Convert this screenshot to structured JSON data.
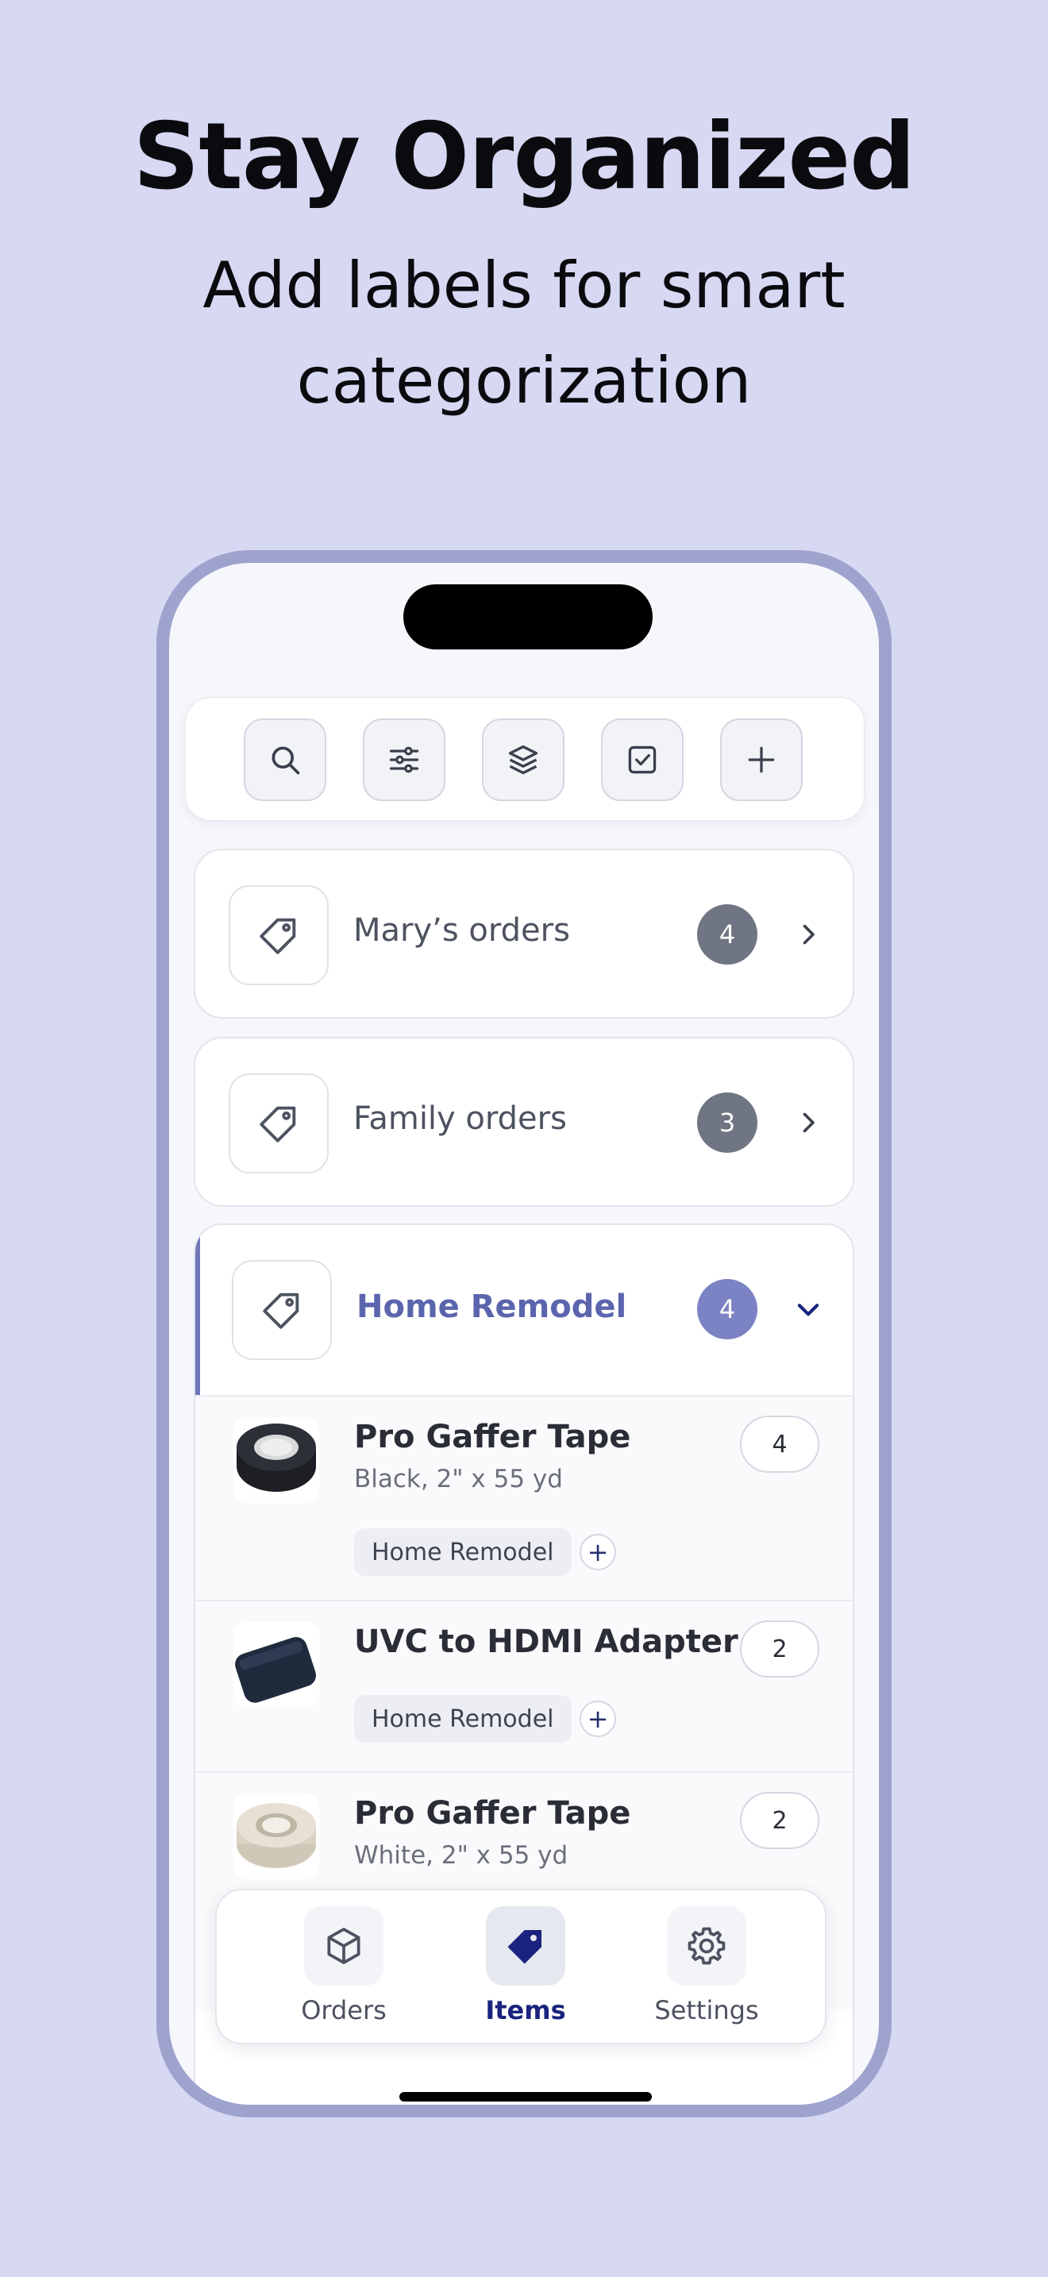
{
  "headline": "Stay Organized",
  "subheadline": "Add labels for smart categorization",
  "colors": {
    "background": "#d7d8f2",
    "phone_frame": "#9ea3ce",
    "badge_gray": "#707583",
    "accent_blue": "#7c83c4",
    "tab_active": "#1a237e"
  },
  "toolbar": {
    "buttons": [
      {
        "icon": "search-icon"
      },
      {
        "icon": "sliders-icon"
      },
      {
        "icon": "layers-icon"
      },
      {
        "icon": "checkbox-icon"
      },
      {
        "icon": "plus-icon"
      }
    ]
  },
  "labels": [
    {
      "name": "Mary’s orders",
      "count": "4",
      "icon": "tag-icon",
      "expanded": false
    },
    {
      "name": "Family orders",
      "count": "3",
      "icon": "tag-icon",
      "expanded": false
    },
    {
      "name": "Home Remodel",
      "count": "4",
      "icon": "tag-icon",
      "expanded": true
    }
  ],
  "items": [
    {
      "title": "Pro Gaffer Tape",
      "subtitle": "Black, 2\" x 55 yd",
      "qty": "4",
      "tag": "Home Remodel",
      "image": "black-tape-roll"
    },
    {
      "title": "UVC to HDMI Adapter",
      "subtitle": "",
      "qty": "2",
      "tag": "Home Remodel",
      "image": "hdmi-adapter"
    },
    {
      "title": "Pro Gaffer Tape",
      "subtitle": "White, 2\" x 55 yd",
      "qty": "2",
      "tag": "",
      "image": "white-tape-roll"
    }
  ],
  "tabs": [
    {
      "label": "Orders",
      "icon": "box-icon",
      "active": false
    },
    {
      "label": "Items",
      "icon": "tag-icon",
      "active": true
    },
    {
      "label": "Settings",
      "icon": "gear-icon",
      "active": false
    }
  ]
}
